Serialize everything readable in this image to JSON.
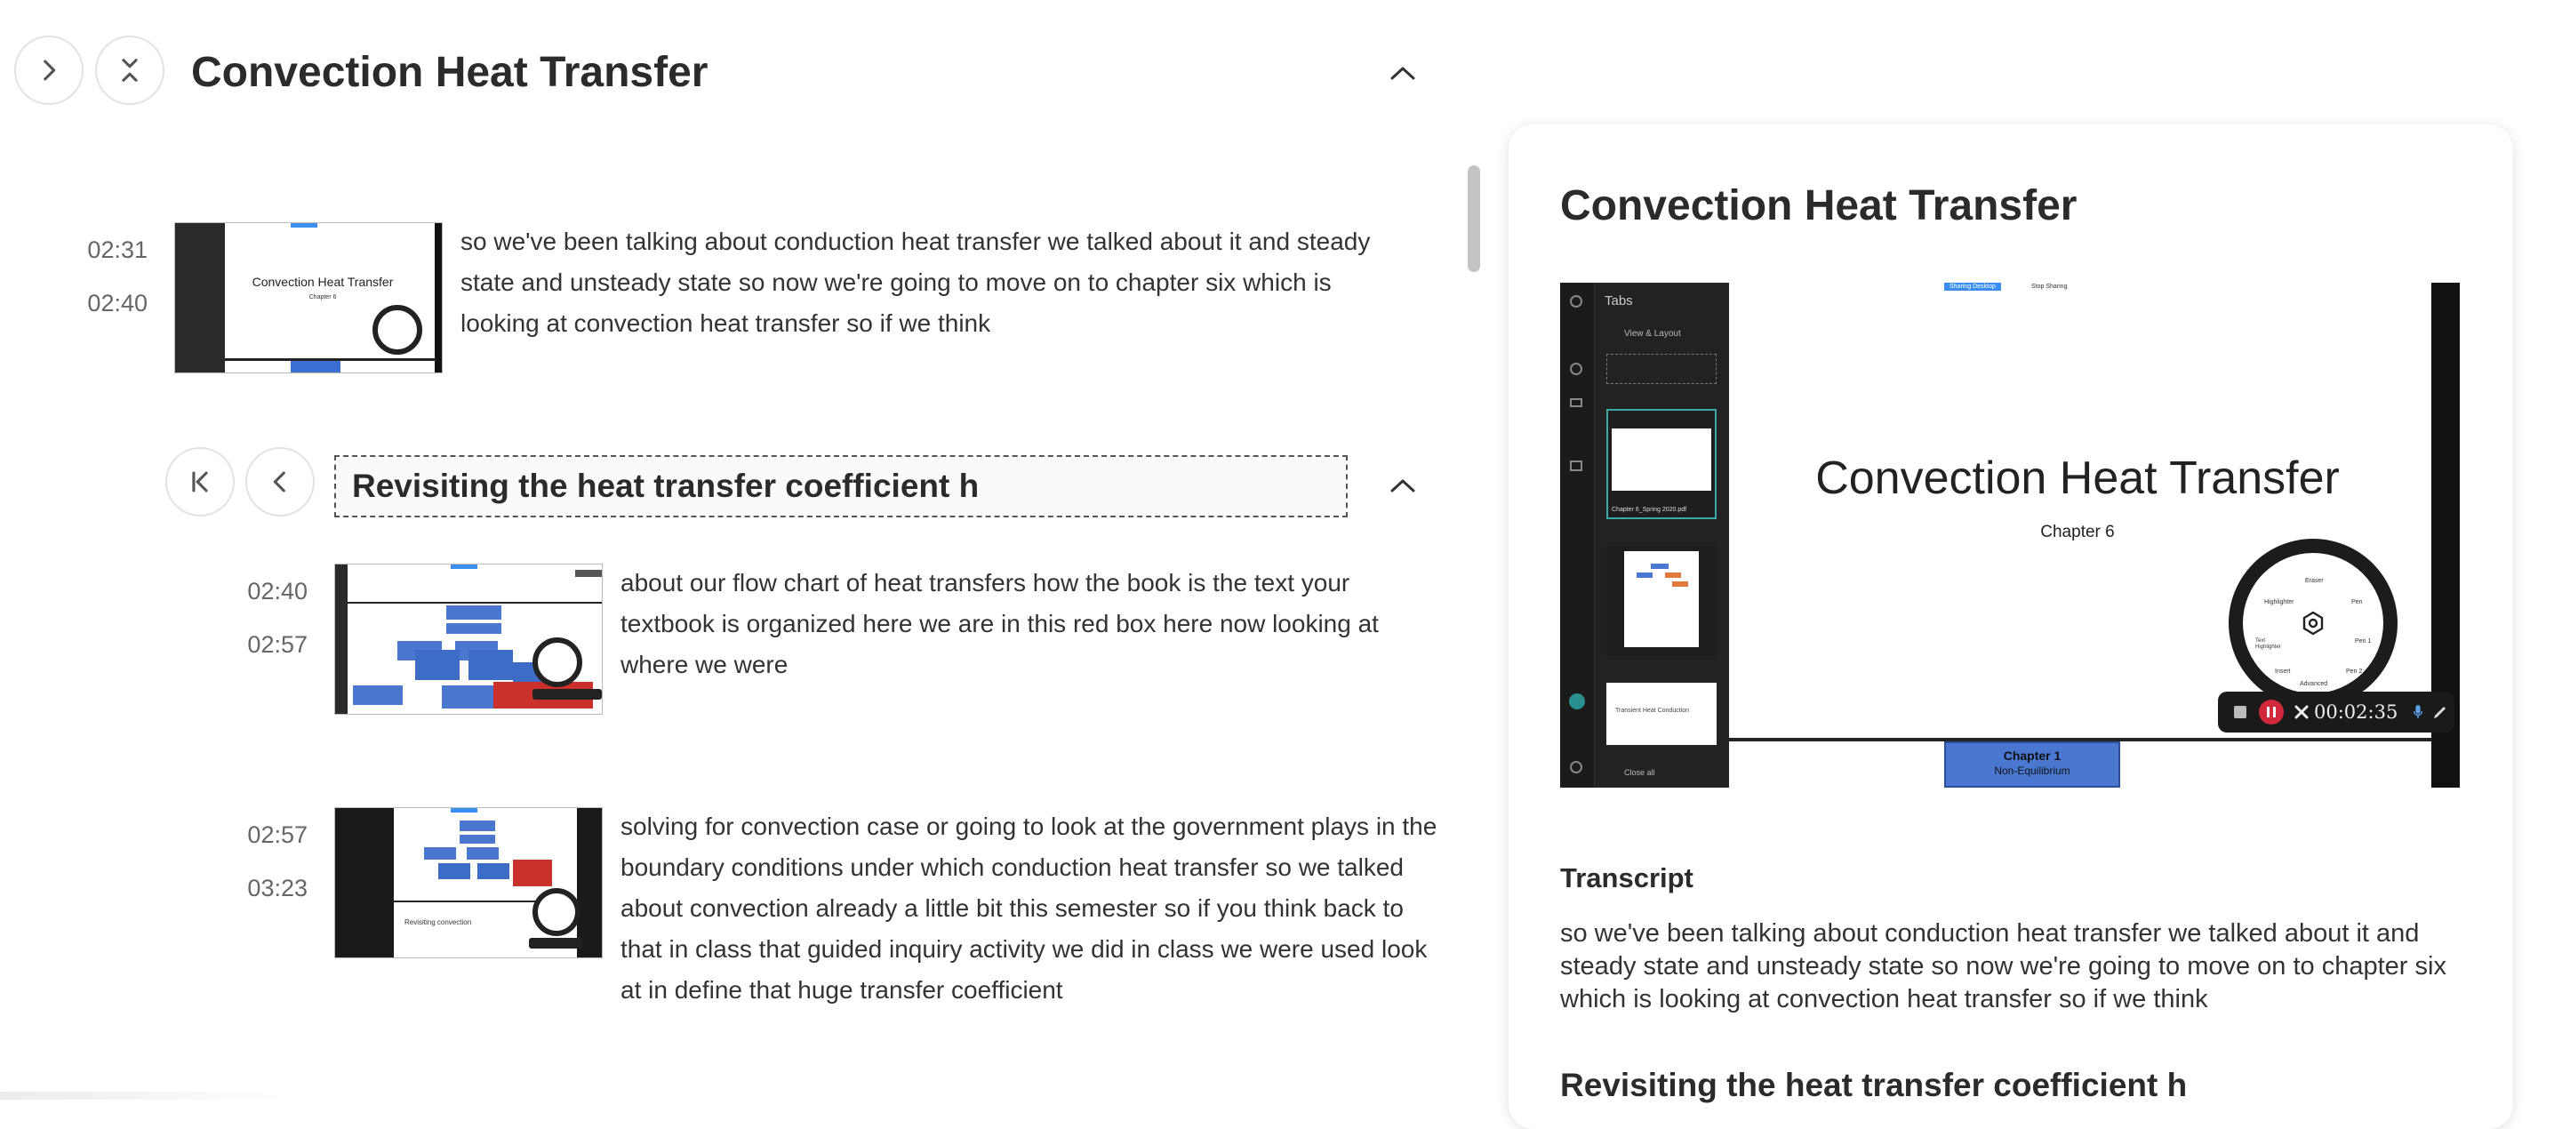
{
  "chapter": {
    "title": "Convection Heat Transfer"
  },
  "section": {
    "title": "Revisiting the heat transfer coefficient h"
  },
  "segments": [
    {
      "start": "02:31",
      "end": "02:40",
      "text": "so we've been talking about conduction heat transfer we talked about it and steady state and unsteady state so now we're going to move on to chapter six which is looking at convection heat transfer so if we think",
      "thumb_title": "Convection Heat Transfer",
      "thumb_subtitle": "Chapter 6"
    },
    {
      "start": "02:40",
      "end": "02:57",
      "text": "about our flow chart of heat transfers how the book is the text your textbook is organized here we are in this red box here now looking at where we were"
    },
    {
      "start": "02:57",
      "end": "03:23",
      "text": "solving for convection case or going to look at the government plays in the boundary conditions under which conduction heat transfer so we talked about convection already a little bit this semester so if you think back to that in class that guided inquiry activity we did in class we were used look at in define that huge transfer coefficient",
      "thumb_caption": "Revisiting convection"
    }
  ],
  "panel": {
    "title": "Convection Heat Transfer",
    "transcript_heading": "Transcript",
    "transcript_text": "so we've been talking about conduction heat transfer we talked about it and steady state and unsteady state so now we're going to move on to chapter six which is looking at convection heat transfer so if we think",
    "next_heading": "Revisiting the heat transfer coefficient h"
  },
  "video": {
    "slide_title": "Convection Heat Transfer",
    "slide_subtitle": "Chapter 6",
    "tabs_label": "Tabs",
    "view_layout_label": "View & Layout",
    "tab_file_label": "Chapter 6_Spring 2020.pdf",
    "tab_transient_label": "Transient Heat Conduction",
    "close_all_label": "Close all",
    "sharing_label": "Sharing Desktop",
    "stop_sharing_label": "Stop Sharing",
    "timer": "00:02:35",
    "bottom_box_title": "Chapter 1",
    "bottom_box_sub": "Non-Equilibrium",
    "wheel": {
      "highlighter": "Highlighter",
      "eraser": "Eraser",
      "pen": "Pen",
      "text_highlighter": "Text Highlighter",
      "insert": "Insert",
      "advanced": "Advanced",
      "pen1": "Pen 1",
      "pen2": "Pen 2"
    }
  },
  "colors": {
    "accent_blue": "#3b6fd4",
    "record_red": "#d2283c"
  }
}
